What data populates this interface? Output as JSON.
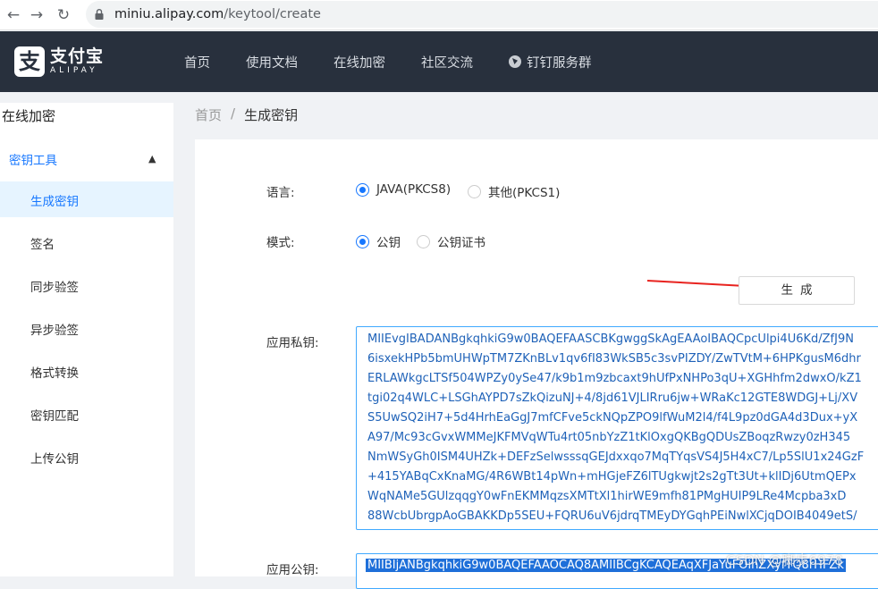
{
  "browser": {
    "url_host": "miniu.alipay.com",
    "url_path": "/keytool/create"
  },
  "header": {
    "logo_cn": "支付宝",
    "logo_en": "ALIPAY",
    "logo_mark": "支",
    "nav": [
      "首页",
      "使用文档",
      "在线加密",
      "社区交流",
      "钉钉服务群"
    ]
  },
  "sidebar": {
    "title": "在线加密",
    "group": "密钥工具",
    "items": [
      "生成密钥",
      "签名",
      "同步验签",
      "异步验签",
      "格式转换",
      "密钥匹配",
      "上传公钥"
    ],
    "active_index": 0
  },
  "breadcrumb": {
    "home": "首页",
    "separator": "/",
    "current": "生成密钥"
  },
  "form": {
    "language_label": "语言:",
    "language_options": [
      "JAVA(PKCS8)",
      "其他(PKCS1)"
    ],
    "language_selected": "JAVA(PKCS8)",
    "mode_label": "模式:",
    "mode_options": [
      "公钥",
      "公钥证书"
    ],
    "mode_selected": "公钥",
    "generate_button": "生成",
    "private_key_label": "应用私钥:",
    "private_key_lines": [
      "MIIEvgIBADANBgkqhkiG9w0BAQEFAASCBKgwggSkAgEAAoIBAQCpcUlpi4U6Kd/ZfJ9N",
      "6isxekHPb5bmUHWpTM7ZKnBLv1qv6fI83WkSB5c3svPIZDY/ZwTVtM+6HPKgusM6dhr",
      "ERLAWkgcLTSf504WPZy0ySe47/k9b1m9zbcaxt9hUfPxNHPo3qU+XGHhfm2dwxO/kZ1",
      "tgi02q4WLC+LSGhAYPD7sZkQizuNJ+4/8jd61VJLIRru6jw+WRaKc12GTE8WDGJ+Lj/XV",
      "S5UwSQ2iH7+5d4HrhEaGgJ7mfCFve5ckNQpZPO9lfWuM2l4/f4L9pz0dGA4d3Dux+yX",
      "A97/Mc93cGvxWMMeJKFMVqWTu4rt05nbYzZ1tKlOxgQKBgQDUsZBoqzRwzy0zH345",
      "NmWSyGh0ISM4UHZk+DEFzSelwsssqGEJdxxqo7MqTYqsVS4J5H4xC7/Lp5SlU1x24GzF",
      "+415YABqCxKnaMG/4R6WBt14pWn+mHGjeFZ6lTUgkwjt2s2gTt3Ut+klIDj6UtmQEPx",
      "WqNAMe5GUlzqqgY0wFnEKMMqzsXMTtXl1hirWE9mfh81PMgHUIP9LRe4Mcpba3xD",
      "88WcbUbrgpAoGBAKKDp5SEU+FQRU6uV6jdrqTMEyDYGqhPEiNwlXCjqDOIB4049etS/"
    ],
    "public_key_label": "应用公钥:",
    "public_key_value": "MIIBIjANBgkqhkiG9w0BAQEFAAOCAQ8AMIIBCgKCAQEAqXFJaYuFOinZXyfTQ8rHFZk"
  },
  "watermark": "CSDN @脚步6978",
  "colors": {
    "accent": "#1677ff",
    "header_bg": "#28303d",
    "arrow": "#e8231f"
  }
}
